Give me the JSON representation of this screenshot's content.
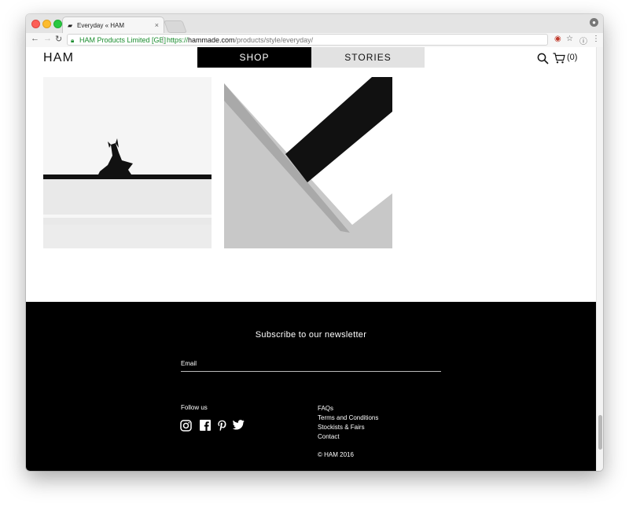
{
  "browser": {
    "tab_title": "Everyday « HAM",
    "tab_close": "×",
    "cert_name": "HAM Products Limited [GB]",
    "url_scheme": "https://",
    "url_host": "hammade.com",
    "url_path": "/products/style/everyday/"
  },
  "site": {
    "logo": "HAM",
    "nav": {
      "shop": "SHOP",
      "stories": "STORIES"
    },
    "cart_count": "(0)"
  },
  "footer": {
    "newsletter_title": "Subscribe to our newsletter",
    "email_placeholder": "Email",
    "follow_label": "Follow us",
    "social_icons": [
      "instagram-icon",
      "facebook-icon",
      "pinterest-icon",
      "twitter-icon"
    ],
    "links": [
      "FAQs",
      "Terms and Conditions",
      "Stockists & Fairs",
      "Contact"
    ],
    "copyright": "© HAM 2016"
  },
  "colors": {
    "accent": "#000000",
    "nav_inactive": "#e2e2e2",
    "secure_green": "#1a8c2e"
  }
}
